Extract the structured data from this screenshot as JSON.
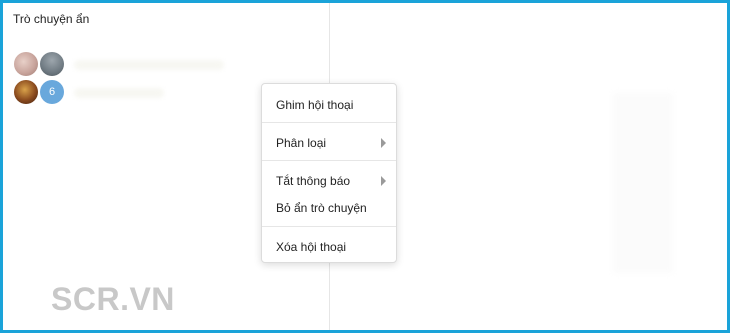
{
  "sidebar": {
    "section_title": "Trò chuyện ẩn",
    "rows": [
      {
        "avatars": [
          "avatar-1",
          "avatar-2"
        ]
      },
      {
        "avatars": [
          "avatar-3"
        ],
        "member_count": "6"
      }
    ]
  },
  "context_menu": {
    "items": [
      {
        "label": "Ghim hội thoại",
        "has_submenu": false
      },
      {
        "label": "Phân loại",
        "has_submenu": true
      },
      {
        "label": "Tắt thông báo",
        "has_submenu": true
      },
      {
        "label": "Bỏ ẩn trò chuyện",
        "has_submenu": false
      },
      {
        "label": "Xóa hội thoại",
        "has_submenu": false
      }
    ],
    "submenu_icon": "chevron-right-icon"
  },
  "watermark": "SCR.VN",
  "colors": {
    "frame_border": "#1aa3d9",
    "count_badge": "#69a8dc",
    "watermark": "#c8c8c8"
  }
}
